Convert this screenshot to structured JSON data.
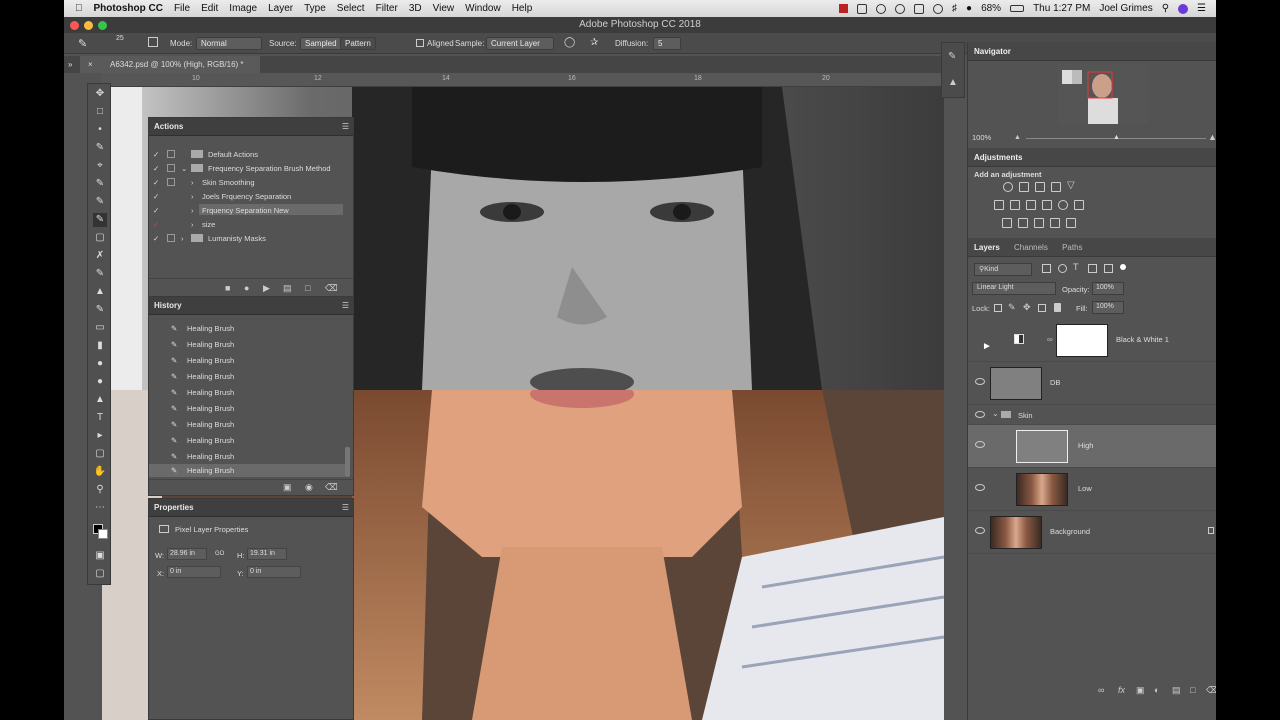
{
  "menubar": {
    "app_name": "Photoshop CC",
    "items": [
      "File",
      "Edit",
      "Image",
      "Layer",
      "Type",
      "Select",
      "Filter",
      "3D",
      "View",
      "Window",
      "Help"
    ],
    "battery": "68%",
    "clock": "Thu 1:27 PM",
    "user": "Joel Grimes"
  },
  "window": {
    "title": "Adobe Photoshop CC 2018"
  },
  "options": {
    "brush_size": "25",
    "mode_label": "Mode:",
    "mode_value": "Normal",
    "source_label": "Source:",
    "source_sampled": "Sampled",
    "source_pattern": "Pattern",
    "aligned_label": "Aligned",
    "sample_label": "Sample:",
    "sample_value": "Current Layer",
    "diffusion_label": "Diffusion:",
    "diffusion_value": "5"
  },
  "document": {
    "tab_title": "A6342.psd @ 100% (High, RGB/16) *"
  },
  "ruler": {
    "ticks": [
      "10",
      "12",
      "14",
      "16",
      "18",
      "20"
    ]
  },
  "actions": {
    "title": "Actions",
    "items": [
      {
        "label": "Default Actions"
      },
      {
        "label": "Frequency Separation Brush Method"
      },
      {
        "label": "Skin Smoothing"
      },
      {
        "label": "Joels Frquency Separation"
      },
      {
        "label": "Frquency Separation New"
      },
      {
        "label": "size"
      },
      {
        "label": "Lumanisty Masks"
      }
    ]
  },
  "history": {
    "title": "History",
    "items": [
      "Healing Brush",
      "Healing Brush",
      "Healing Brush",
      "Healing Brush",
      "Healing Brush",
      "Healing Brush",
      "Healing Brush",
      "Healing Brush",
      "Healing Brush",
      "Healing Brush"
    ]
  },
  "properties": {
    "title": "Properties",
    "subtitle": "Pixel Layer Properties",
    "w_label": "W:",
    "w_value": "28.96 in",
    "link": "GO",
    "h_label": "H:",
    "h_value": "19.31 in",
    "x_label": "X:",
    "x_value": "0 in",
    "y_label": "Y:",
    "y_value": "0 in"
  },
  "navigator": {
    "title": "Navigator",
    "zoom": "100%"
  },
  "adjustments": {
    "title": "Adjustments",
    "add_label": "Add an adjustment"
  },
  "layers_panel": {
    "tabs": [
      "Layers",
      "Channels",
      "Paths"
    ],
    "filter_kind": "Kind",
    "blend_mode": "Linear Light",
    "opacity_label": "Opacity:",
    "opacity_value": "100%",
    "lock_label": "Lock:",
    "fill_label": "Fill:",
    "fill_value": "100%",
    "layers": [
      {
        "name": "Black & White 1"
      },
      {
        "name": "DB"
      },
      {
        "name": "Skin"
      },
      {
        "name": "High"
      },
      {
        "name": "Low"
      },
      {
        "name": "Background"
      }
    ]
  },
  "colors": {
    "accent_selected": "#6a6a6a",
    "panel_bg": "#535353"
  }
}
